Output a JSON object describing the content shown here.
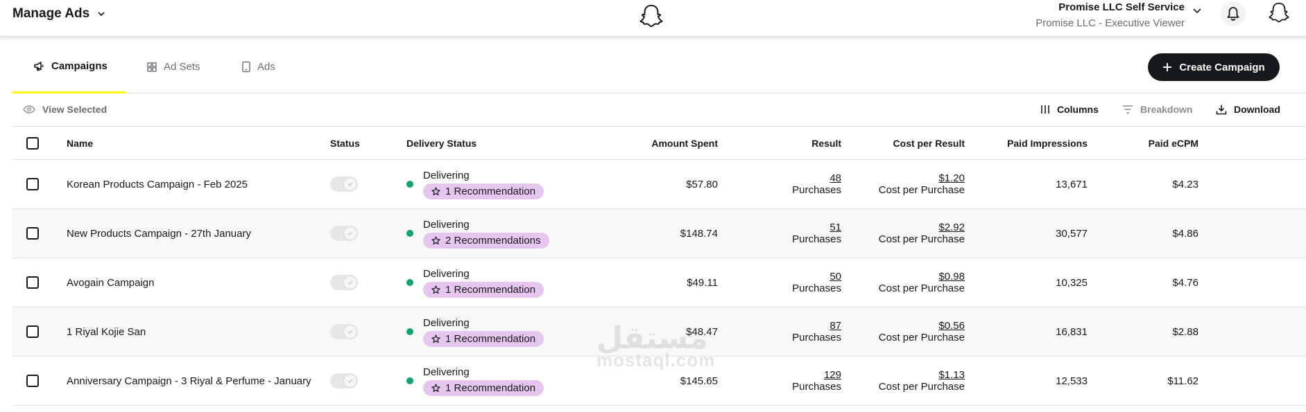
{
  "header": {
    "title": "Manage Ads",
    "account_name": "Promise LLC Self Service",
    "account_role": "Promise LLC - Executive Viewer"
  },
  "tabs": [
    {
      "label": "Campaigns",
      "active": true,
      "icon": "megaphone-icon"
    },
    {
      "label": "Ad Sets",
      "active": false,
      "icon": "grid-icon"
    },
    {
      "label": "Ads",
      "active": false,
      "icon": "phone-icon"
    }
  ],
  "create_button": {
    "label": "Create Campaign"
  },
  "toolbar": {
    "view_selected": "View Selected",
    "columns": "Columns",
    "breakdown": "Breakdown",
    "download": "Download"
  },
  "columns": {
    "name": "Name",
    "status": "Status",
    "delivery_status": "Delivery Status",
    "amount_spent": "Amount Spent",
    "result": "Result",
    "cost_per_result": "Cost per Result",
    "paid_impressions": "Paid Impressions",
    "paid_ecpm": "Paid eCPM"
  },
  "rows": [
    {
      "name": "Korean Products Campaign - Feb 2025",
      "delivery": "Delivering",
      "recommendation": "1 Recommendation",
      "spent": "$57.80",
      "result": "48",
      "result_unit": "Purchases",
      "cpr": "$1.20",
      "cpr_unit": "Cost per Purchase",
      "impressions": "13,671",
      "ecpm": "$4.23"
    },
    {
      "name": "New Products Campaign - 27th January",
      "delivery": "Delivering",
      "recommendation": "2 Recommendations",
      "spent": "$148.74",
      "result": "51",
      "result_unit": "Purchases",
      "cpr": "$2.92",
      "cpr_unit": "Cost per Purchase",
      "impressions": "30,577",
      "ecpm": "$4.86"
    },
    {
      "name": "Avogain Campaign",
      "delivery": "Delivering",
      "recommendation": "1 Recommendation",
      "spent": "$49.11",
      "result": "50",
      "result_unit": "Purchases",
      "cpr": "$0.98",
      "cpr_unit": "Cost per Purchase",
      "impressions": "10,325",
      "ecpm": "$4.76"
    },
    {
      "name": "1 Riyal Kojie San",
      "delivery": "Delivering",
      "recommendation": "1 Recommendation",
      "spent": "$48.47",
      "result": "87",
      "result_unit": "Purchases",
      "cpr": "$0.56",
      "cpr_unit": "Cost per Purchase",
      "impressions": "16,831",
      "ecpm": "$2.88"
    },
    {
      "name": "Anniversary Campaign - 3 Riyal & Perfume - January",
      "delivery": "Delivering",
      "recommendation": "1 Recommendation",
      "spent": "$145.65",
      "result": "129",
      "result_unit": "Purchases",
      "cpr": "$1.13",
      "cpr_unit": "Cost per Purchase",
      "impressions": "12,533",
      "ecpm": "$11.62"
    }
  ],
  "watermark": {
    "arabic": "مستقل",
    "latin": "mostaql.com"
  },
  "colors": {
    "accent_yellow": "#fffc00",
    "delivering_green": "#10a36a",
    "recommendation_bg": "#e6c6ef",
    "primary_button": "#16191c"
  }
}
